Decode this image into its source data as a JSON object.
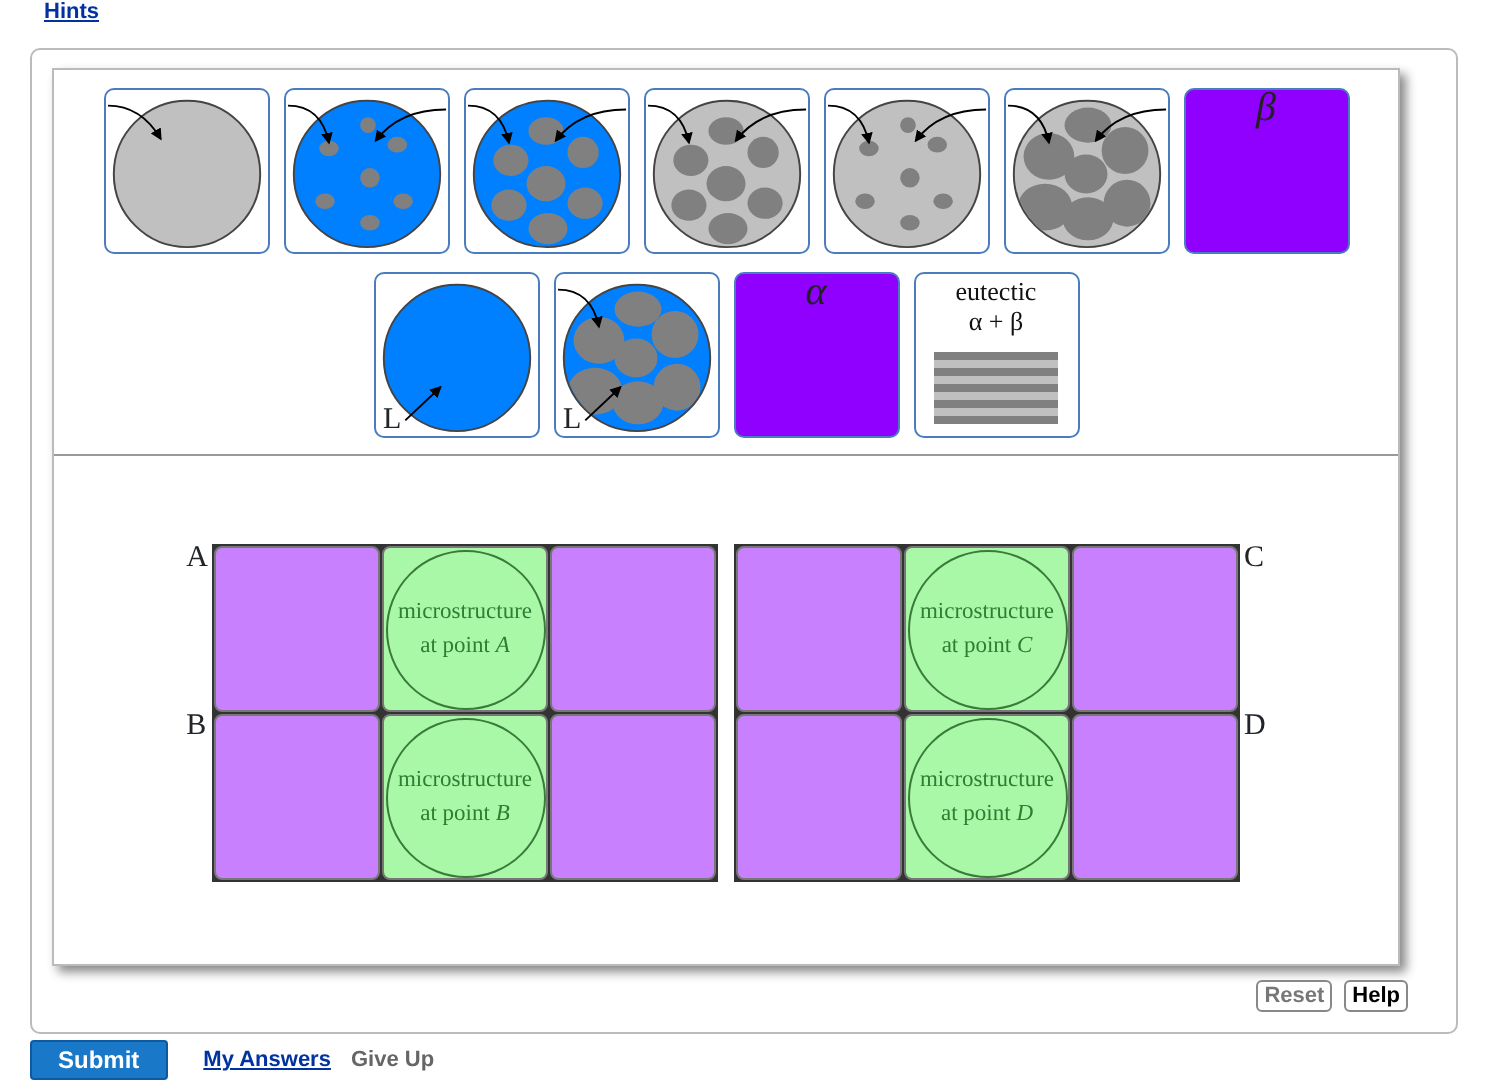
{
  "hints_link": "Hints",
  "palette": {
    "rows": [
      [
        {
          "kind": "plain",
          "color": "#c0c0c0"
        },
        {
          "kind": "sparse",
          "color": "#0080ff"
        },
        {
          "kind": "dense",
          "color": "#0080ff"
        },
        {
          "kind": "dense",
          "color": "#c0c0c0"
        },
        {
          "kind": "sparse",
          "color": "#c0c0c0"
        },
        {
          "kind": "network",
          "color": "#c0c0c0"
        },
        {
          "kind": "phase",
          "label": "β"
        }
      ],
      [
        {
          "kind": "plain",
          "color": "#0080ff",
          "label": "L"
        },
        {
          "kind": "network",
          "color": "#0080ff",
          "label": "L"
        },
        {
          "kind": "phase",
          "label": "α"
        },
        {
          "kind": "eutectic",
          "label": "eutectic",
          "formula": "α + β"
        }
      ]
    ]
  },
  "grids": [
    {
      "kind": "left",
      "rows": [
        {
          "label": "A",
          "caption": "microstructure at point *A*"
        },
        {
          "label": "B",
          "caption": "microstructure at point *B*"
        }
      ]
    },
    {
      "kind": "right",
      "rows": [
        {
          "label": "C",
          "caption": "microstructure at point *C*"
        },
        {
          "label": "D",
          "caption": "microstructure at point *D*"
        }
      ]
    }
  ],
  "tools": [
    {
      "label": "Reset",
      "disabled": true
    },
    {
      "label": "Help",
      "disabled": false
    }
  ],
  "actions": {
    "submit": "Submit",
    "my_answers": "My Answers",
    "give_up": {
      "label": "Give Up",
      "disabled": true
    }
  }
}
